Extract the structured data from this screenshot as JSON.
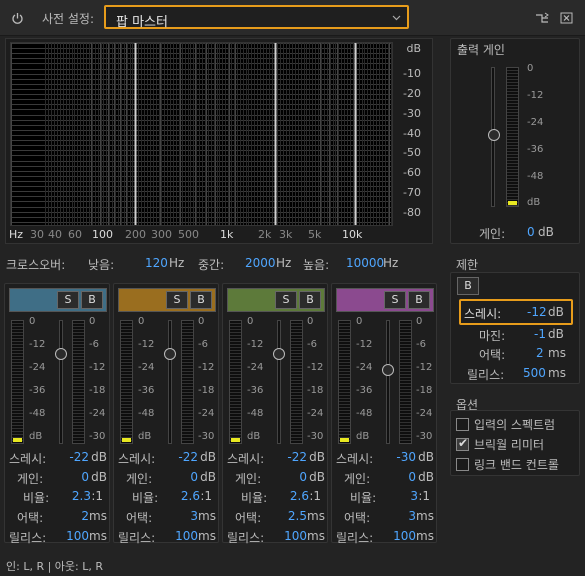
{
  "toolbar": {
    "preset_label": "사전 설정:",
    "preset_value": "팝 마스터"
  },
  "graph": {
    "db_ticks": [
      "dB",
      "-10",
      "-20",
      "-30",
      "-40",
      "-50",
      "-60",
      "-70",
      "-80"
    ],
    "freq_ticks": [
      "Hz",
      "30",
      "40",
      "60",
      "100",
      "200",
      "300",
      "500",
      "1k",
      "2k",
      "3k",
      "5k",
      "10k"
    ]
  },
  "crossover": {
    "label": "크로스오버:",
    "low_label": "낮음:",
    "low_value": "120",
    "low_unit": "Hz",
    "mid_label": "중간:",
    "mid_value": "2000",
    "mid_unit": "Hz",
    "high_label": "높음:",
    "high_value": "10000",
    "high_unit": "Hz"
  },
  "bands": [
    {
      "color": "#3f6e86",
      "s": "S",
      "b": "B",
      "threshold": "-22",
      "gain": "0",
      "ratio": "2.3",
      "attack": "2",
      "release": "100",
      "fader_level": 0.27
    },
    {
      "color": "#9a6e1f",
      "s": "S",
      "b": "B",
      "threshold": "-22",
      "gain": "0",
      "ratio": "2.6",
      "attack": "3",
      "release": "100",
      "fader_level": 0.27
    },
    {
      "color": "#5d7a3a",
      "s": "S",
      "b": "B",
      "threshold": "-22",
      "gain": "0",
      "ratio": "2.6",
      "attack": "2.5",
      "release": "100",
      "fader_level": 0.27
    },
    {
      "color": "#8b4a8f",
      "s": "S",
      "b": "B",
      "threshold": "-30",
      "gain": "0",
      "ratio": "3",
      "attack": "3",
      "release": "100",
      "fader_level": 0.4
    }
  ],
  "band_labels": {
    "threshold": "스레시:",
    "gain": "게인:",
    "ratio": "비율:",
    "attack": "어택:",
    "release": "릴리스:",
    "unit_db": "dB",
    "unit_ms": "ms",
    "unit_ratio": ":1"
  },
  "band_scale_left": [
    "0",
    "-12",
    "-24",
    "-36",
    "-48",
    "dB"
  ],
  "band_scale_right": [
    "0",
    "-6",
    "-12",
    "-18",
    "-24",
    "-30"
  ],
  "output_gain": {
    "title": "출력 게인",
    "scale": [
      "0",
      "-12",
      "-24",
      "-36",
      "-48",
      "dB"
    ],
    "gain_label": "게인:",
    "gain_value": "0",
    "gain_unit": "dB"
  },
  "limiter": {
    "title": "제한",
    "b": "B",
    "threshold_label": "스레시:",
    "threshold_value": "-12",
    "threshold_unit": "dB",
    "margin_label": "마진:",
    "margin_value": "-1",
    "margin_unit": "dB",
    "attack_label": "어택:",
    "attack_value": "2",
    "attack_unit": "ms",
    "release_label": "릴리스:",
    "release_value": "500",
    "release_unit": "ms"
  },
  "options": {
    "title": "옵션",
    "items": [
      {
        "label": "입력의 스펙트럼",
        "checked": false
      },
      {
        "label": "브릭월 리미터",
        "checked": true
      },
      {
        "label": "링크 밴드 컨트롤",
        "checked": false
      }
    ]
  },
  "footer": {
    "io": "인: L, R | 아웃: L, R"
  },
  "colors": {
    "accent": "#4fa6ff",
    "highlight": "#e79c1b",
    "meter_level": "#e8e821"
  }
}
